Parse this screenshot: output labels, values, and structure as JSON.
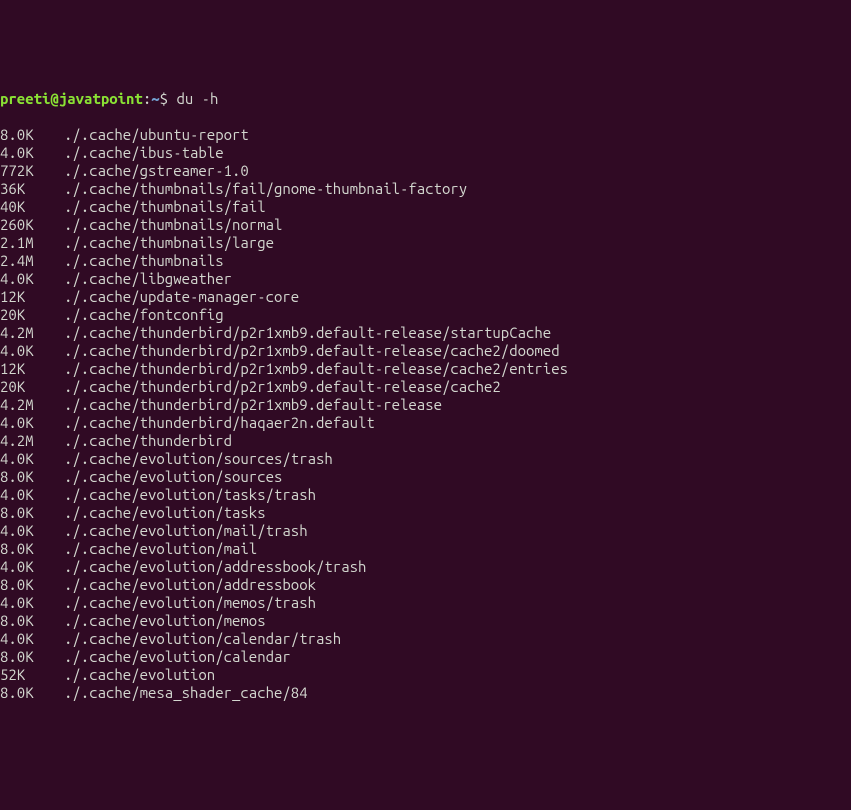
{
  "prompt": {
    "user": "preeti",
    "at": "@",
    "host": "javatpoint",
    "colon": ":",
    "path": "~",
    "dollar": "$ ",
    "command": "du -h"
  },
  "output": [
    {
      "size": "8.0K",
      "path": "./.cache/ubuntu-report"
    },
    {
      "size": "4.0K",
      "path": "./.cache/ibus-table"
    },
    {
      "size": "772K",
      "path": "./.cache/gstreamer-1.0"
    },
    {
      "size": "36K",
      "path": "./.cache/thumbnails/fail/gnome-thumbnail-factory"
    },
    {
      "size": "40K",
      "path": "./.cache/thumbnails/fail"
    },
    {
      "size": "260K",
      "path": "./.cache/thumbnails/normal"
    },
    {
      "size": "2.1M",
      "path": "./.cache/thumbnails/large"
    },
    {
      "size": "2.4M",
      "path": "./.cache/thumbnails"
    },
    {
      "size": "4.0K",
      "path": "./.cache/libgweather"
    },
    {
      "size": "12K",
      "path": "./.cache/update-manager-core"
    },
    {
      "size": "20K",
      "path": "./.cache/fontconfig"
    },
    {
      "size": "4.2M",
      "path": "./.cache/thunderbird/p2r1xmb9.default-release/startupCache"
    },
    {
      "size": "4.0K",
      "path": "./.cache/thunderbird/p2r1xmb9.default-release/cache2/doomed"
    },
    {
      "size": "12K",
      "path": "./.cache/thunderbird/p2r1xmb9.default-release/cache2/entries"
    },
    {
      "size": "20K",
      "path": "./.cache/thunderbird/p2r1xmb9.default-release/cache2"
    },
    {
      "size": "4.2M",
      "path": "./.cache/thunderbird/p2r1xmb9.default-release"
    },
    {
      "size": "4.0K",
      "path": "./.cache/thunderbird/haqaer2n.default"
    },
    {
      "size": "4.2M",
      "path": "./.cache/thunderbird"
    },
    {
      "size": "4.0K",
      "path": "./.cache/evolution/sources/trash"
    },
    {
      "size": "8.0K",
      "path": "./.cache/evolution/sources"
    },
    {
      "size": "4.0K",
      "path": "./.cache/evolution/tasks/trash"
    },
    {
      "size": "8.0K",
      "path": "./.cache/evolution/tasks"
    },
    {
      "size": "4.0K",
      "path": "./.cache/evolution/mail/trash"
    },
    {
      "size": "8.0K",
      "path": "./.cache/evolution/mail"
    },
    {
      "size": "4.0K",
      "path": "./.cache/evolution/addressbook/trash"
    },
    {
      "size": "8.0K",
      "path": "./.cache/evolution/addressbook"
    },
    {
      "size": "4.0K",
      "path": "./.cache/evolution/memos/trash"
    },
    {
      "size": "8.0K",
      "path": "./.cache/evolution/memos"
    },
    {
      "size": "4.0K",
      "path": "./.cache/evolution/calendar/trash"
    },
    {
      "size": "8.0K",
      "path": "./.cache/evolution/calendar"
    },
    {
      "size": "52K",
      "path": "./.cache/evolution"
    },
    {
      "size": "8.0K",
      "path": "./.cache/mesa_shader_cache/84"
    }
  ]
}
